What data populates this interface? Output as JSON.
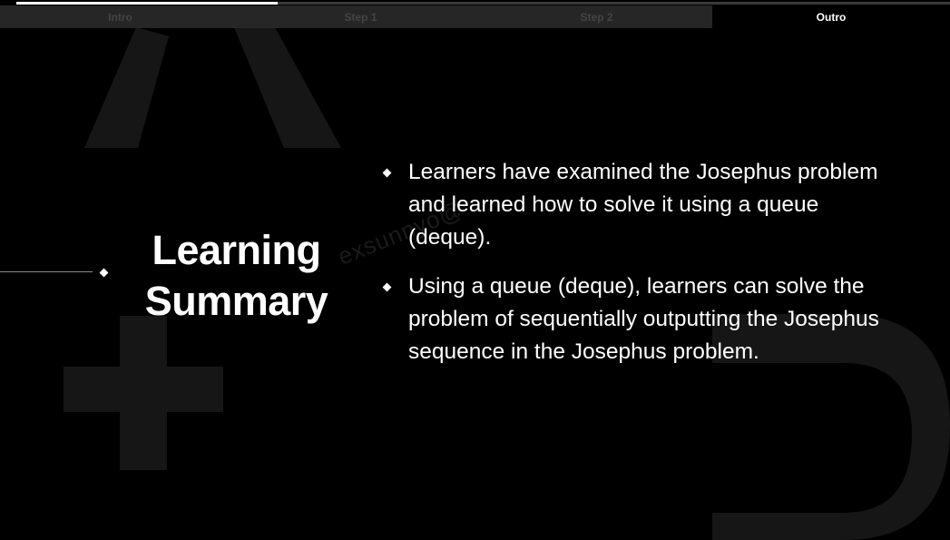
{
  "progress": {
    "fraction": 0.28
  },
  "tabs": [
    {
      "label": "Intro",
      "active": false
    },
    {
      "label": "Step 1",
      "active": false
    },
    {
      "label": "Step 2",
      "active": false
    },
    {
      "label": "Outro",
      "active": true
    }
  ],
  "slide": {
    "title_line1": "Learning",
    "title_line2": "Summary",
    "points": [
      "Learners have examined the Josephus problem and learned how to solve it using a queue (deque).",
      "Using a queue (deque), learners can solve the problem of sequentially outputting the Josephus sequence in the Josephus problem."
    ]
  },
  "watermark": {
    "text": "exsunnyo@"
  },
  "colors": {
    "background": "#000000",
    "tab_inactive": "#262626",
    "tab_inactive_text": "#444444",
    "tab_active_text": "#ffffff",
    "decor_shape": "#161616",
    "text": "#ffffff"
  }
}
